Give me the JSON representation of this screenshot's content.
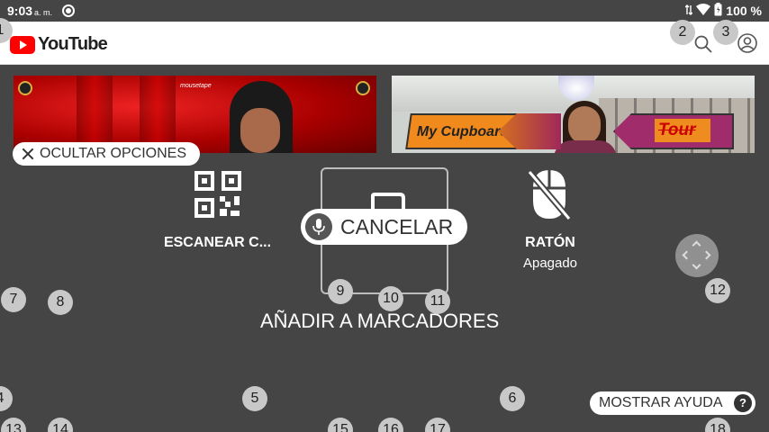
{
  "status_bar": {
    "time": "9:03",
    "ampm": "a. m.",
    "battery": "100 %",
    "icons": [
      "settings-dot-icon",
      "data-arrows-icon",
      "wifi-icon",
      "battery-icon"
    ]
  },
  "youtube": {
    "logo_text": "YouTube",
    "brand_color": "#ff0000",
    "icons": [
      "search-icon",
      "account-icon"
    ]
  },
  "thumbnails": [
    {
      "id": "video-1",
      "overlay_text": "mousetape"
    },
    {
      "id": "video-2",
      "overlay_text": "My Cupboard",
      "overlay_text_2": "Tour"
    }
  ],
  "overlay": {
    "hide_options_label": "OCULTAR OPCIONES",
    "scan_label": "ESCANEAR C...",
    "mouse_label": "RATÓN",
    "mouse_state": "Apagado",
    "cancel_label": "CANCELAR",
    "bookmark_label": "AÑADIR A MARCADORES",
    "help_label": "MOSTRAR AYUDA",
    "help_icon": "?"
  },
  "markers": [
    "1",
    "2",
    "3",
    "4",
    "5",
    "6",
    "7",
    "8",
    "9",
    "10",
    "11",
    "12",
    "13",
    "14",
    "15",
    "16",
    "17",
    "18"
  ]
}
